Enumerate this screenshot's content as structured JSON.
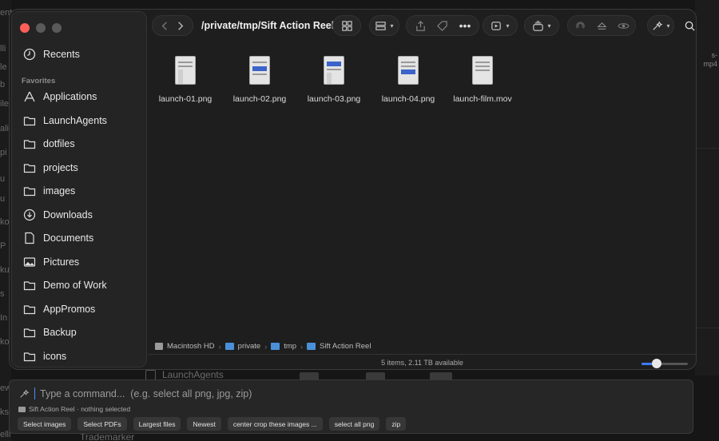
{
  "background": {
    "left_letters": [
      "ent",
      "lli",
      "le",
      "b",
      "ile",
      "ali",
      "pi",
      "u",
      "u",
      "ko",
      "P",
      "ku",
      "s",
      "In",
      "ko",
      "ew",
      "ks",
      "elli"
    ],
    "right_text": [
      "s-",
      "mp4"
    ],
    "bottom_row_label": "LaunchAgents",
    "bottom_text": "Trademarker"
  },
  "finder": {
    "path_title": "/private/tmp/Sift Action Reel",
    "sidebar": {
      "recents": "Recents",
      "favorites_label": "Favorites",
      "items": [
        {
          "label": "Applications",
          "icon": "applications-icon"
        },
        {
          "label": "LaunchAgents",
          "icon": "folder-icon"
        },
        {
          "label": "dotfiles",
          "icon": "folder-icon"
        },
        {
          "label": "projects",
          "icon": "folder-icon"
        },
        {
          "label": "images",
          "icon": "folder-icon"
        },
        {
          "label": "Downloads",
          "icon": "downloads-icon"
        },
        {
          "label": "Documents",
          "icon": "document-icon"
        },
        {
          "label": "Pictures",
          "icon": "pictures-icon"
        },
        {
          "label": "Demo of Work",
          "icon": "folder-icon"
        },
        {
          "label": "AppPromos",
          "icon": "folder-icon"
        },
        {
          "label": "Backup",
          "icon": "folder-icon"
        },
        {
          "label": "icons",
          "icon": "folder-icon"
        }
      ]
    },
    "files": [
      {
        "name": "launch-01.png"
      },
      {
        "name": "launch-02.png"
      },
      {
        "name": "launch-03.png"
      },
      {
        "name": "launch-04.png"
      },
      {
        "name": "launch-film.mov"
      }
    ],
    "pathbar": [
      "Macintosh HD",
      "private",
      "tmp",
      "Sift Action Reel"
    ],
    "status": "5 items, 2.11 TB available",
    "zoom_fraction": 0.32,
    "accent": "#3d7bf5"
  },
  "command": {
    "placeholder": "Type a command...  (e.g. select all png, jpg, zip)",
    "context": "Sift Action Reel · nothing selected",
    "chips": [
      "Select images",
      "Select PDFs",
      "Largest files",
      "Newest",
      "center crop these images ...",
      "select all png",
      "zip"
    ]
  }
}
